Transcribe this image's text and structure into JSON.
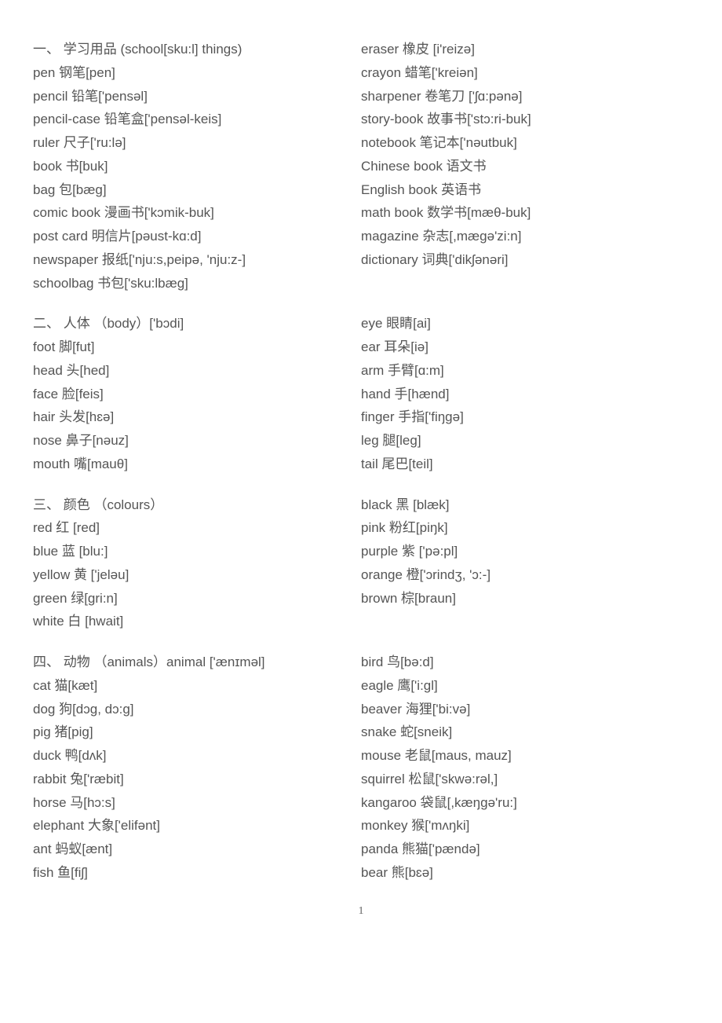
{
  "page_number": "1",
  "sections": [
    {
      "heading": "一、 学习用品 (school[sku:l] things)",
      "left": [
        "pen 钢笔[pen]",
        "pencil 铅笔['pensəl]",
        "pencil-case 铅笔盒['pensəl-keis]",
        "ruler 尺子['ru:lə]",
        "book 书[buk]",
        "bag 包[bæg]",
        "comic book 漫画书['kɔmik-buk]",
        "post card 明信片[pəust-kɑ:d]",
        "newspaper 报纸['nju:s,peipə, 'nju:z-]",
        "schoolbag 书包['sku:lbæg]"
      ],
      "right": [
        "eraser 橡皮 [i'reizə]",
        "crayon 蜡笔['kreiən]",
        "sharpener 卷笔刀 ['ʃɑ:pənə]",
        "story-book 故事书['stɔ:ri-buk]",
        "notebook 笔记本['nəutbuk]",
        "Chinese book 语文书",
        "English book 英语书",
        "math book 数学书[mæθ-buk]",
        "magazine 杂志[,mægə'zi:n]",
        "dictionary 词典['dikʃənəri]"
      ]
    },
    {
      "heading": "二、 人体 （body）['bɔdi]",
      "left": [
        "foot 脚[fut]",
        "head 头[hed]",
        "face 脸[feis]",
        "hair 头发[hɛə]",
        "nose 鼻子[nəuz]",
        "mouth 嘴[mauθ]"
      ],
      "right": [
        "eye 眼睛[ai]",
        "ear 耳朵[iə]",
        "arm 手臂[ɑ:m]",
        "hand 手[hænd]",
        "finger 手指['fiŋgə]",
        "leg 腿[leg]",
        "tail 尾巴[teil]"
      ]
    },
    {
      "heading": "三、 颜色 （colours）",
      "left": [
        "red 红 [red]",
        "blue 蓝 [blu:]",
        "yellow 黄 ['jeləu]",
        "green 绿[gri:n]",
        "white 白 [hwait]"
      ],
      "right": [
        "black 黑 [blæk]",
        "pink 粉红[piŋk]",
        "purple 紫 ['pə:pl]",
        "orange 橙['ɔrindʒ, 'ɔ:-]",
        "brown 棕[braun]"
      ]
    },
    {
      "heading": "四、 动物 （animals）animal ['ænɪməl]",
      "left": [
        "cat 猫[kæt]",
        "dog 狗[dɔg, dɔ:g]",
        "pig 猪[pig]",
        "duck 鸭[dʌk]",
        "rabbit 兔['ræbit]",
        "horse 马[hɔ:s]",
        "elephant 大象['elifənt]",
        "ant 蚂蚁[ænt]",
        "fish 鱼[fiʃ]"
      ],
      "right": [
        "bird 鸟[bə:d]",
        "eagle 鹰['i:gl]",
        "beaver 海狸['bi:və]",
        "snake 蛇[sneik]",
        "mouse 老鼠[maus, mauz]",
        "squirrel 松鼠['skwə:rəl,]",
        "kangaroo 袋鼠[,kæŋgə'ru:]",
        "monkey 猴['mʌŋki]",
        "panda 熊猫['pændə]",
        "bear 熊[bɛə]"
      ]
    }
  ]
}
